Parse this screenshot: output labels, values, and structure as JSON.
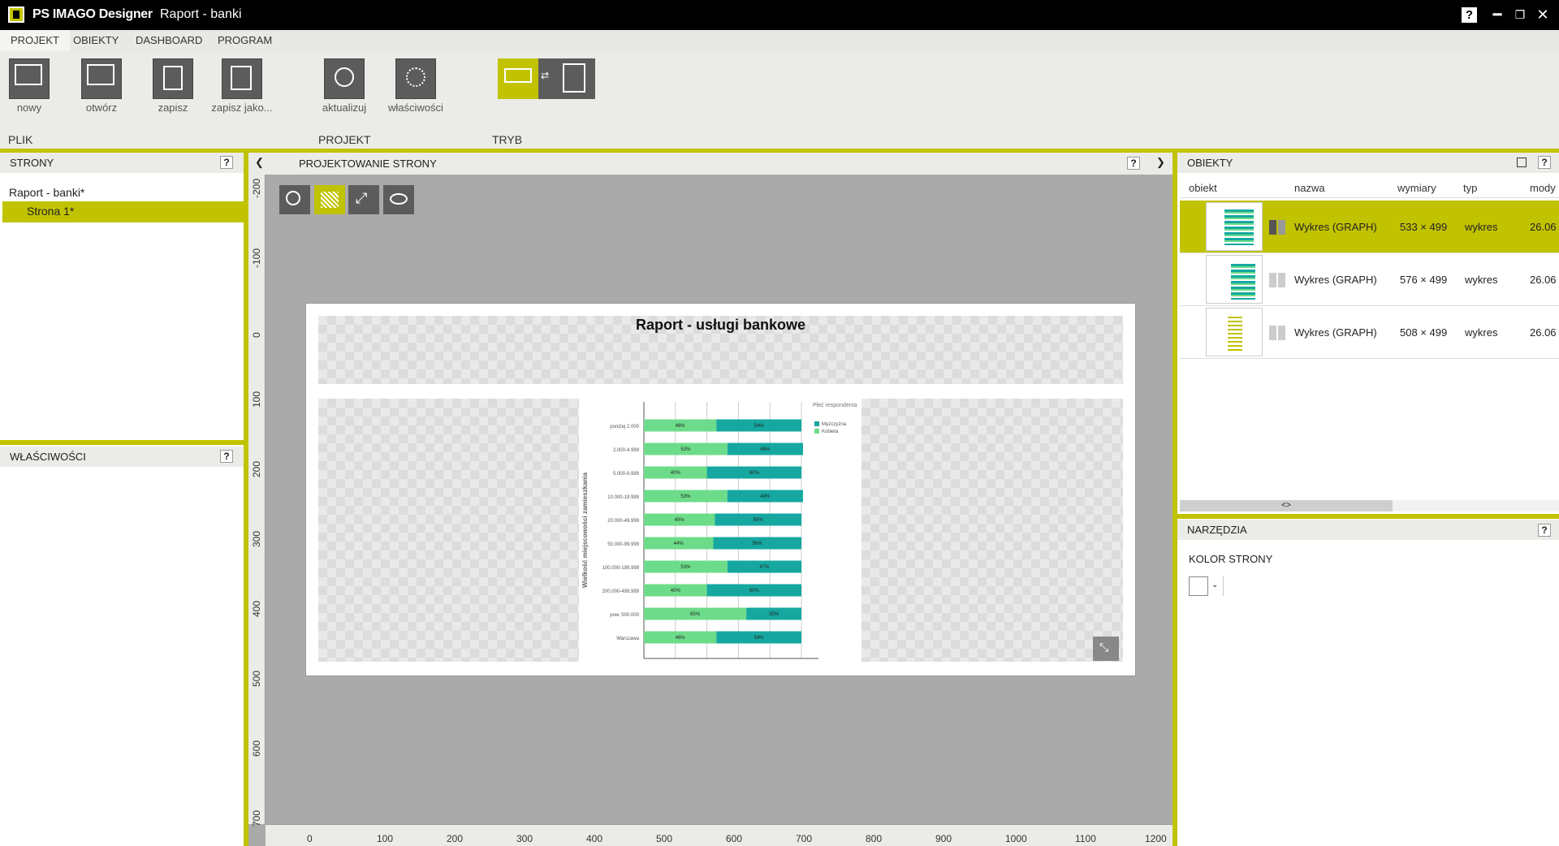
{
  "app": {
    "name": "PS IMAGO Designer",
    "document": "Raport - banki"
  },
  "menu": [
    "PROJEKT",
    "OBIEKTY",
    "DASHBOARD",
    "PROGRAM"
  ],
  "ribbon": {
    "buttons": [
      "nowy",
      "otwórz",
      "zapisz",
      "zapisz jako...",
      "aktualizuj",
      "właściwości"
    ],
    "groups": [
      "PLIK",
      "PROJEKT",
      "TRYB"
    ]
  },
  "left": {
    "pages_title": "STRONY",
    "project": "Raport - banki*",
    "page": "Strona 1*",
    "props_title": "WŁAŚCIWOŚCI"
  },
  "center": {
    "title": "PROJEKTOWANIE STRONY",
    "page_title": "Raport - usługi bankowe",
    "vruler": [
      "-200",
      "-100",
      "0",
      "100",
      "200",
      "300",
      "400",
      "500",
      "600",
      "700"
    ],
    "hruler": [
      "0",
      "100",
      "200",
      "300",
      "400",
      "500",
      "600",
      "700",
      "800",
      "900",
      "1000",
      "1100",
      "1200"
    ]
  },
  "chart_data": {
    "type": "bar",
    "stacked": true,
    "ylabel": "Wielkość miejscowości zamieszkania",
    "legend_title": "Płeć respondenta",
    "categories": [
      "poniżej 2.000",
      "2.000-4.999",
      "5.000-9.999",
      "10.000-19.999",
      "20.000-49.999",
      "50.000-99.999",
      "100.000-199.999",
      "200.000-499.999",
      "pow. 500.000",
      "Warszawa"
    ],
    "series": [
      {
        "name": "Kobieta",
        "color": "#6ddc8a",
        "values": [
          46,
          53,
          40,
          53,
          45,
          44,
          53,
          40,
          65,
          46
        ]
      },
      {
        "name": "Mężczyzna",
        "color": "#16a8a0",
        "values": [
          54,
          48,
          60,
          48,
          55,
          56,
          47,
          60,
          35,
          54
        ]
      }
    ],
    "labels": [
      [
        "46%",
        "54%"
      ],
      [
        "53%",
        "48%"
      ],
      [
        "40%",
        "60%"
      ],
      [
        "53%",
        "48%"
      ],
      [
        "45%",
        "55%"
      ],
      [
        "44%",
        "56%"
      ],
      [
        "53%",
        "47%"
      ],
      [
        "40%",
        "60%"
      ],
      [
        "65%",
        "35%"
      ],
      [
        "46%",
        "54%"
      ]
    ],
    "xlim": [
      0,
      100
    ]
  },
  "right": {
    "objects_title": "OBIEKTY",
    "columns": [
      "obiekt",
      "nazwa",
      "wymiary",
      "typ",
      "mody"
    ],
    "rows": [
      {
        "name": "Wykres (GRAPH)",
        "size": "533 × 499",
        "type": "wykres",
        "mod": "26.06"
      },
      {
        "name": "Wykres (GRAPH)",
        "size": "576 × 499",
        "type": "wykres",
        "mod": "26.06"
      },
      {
        "name": "Wykres (GRAPH)",
        "size": "508 × 499",
        "type": "wykres",
        "mod": "26.06"
      }
    ],
    "scroll": "<>",
    "tools_title": "NARZĘDZIA",
    "page_color_label": "KOLOR STRONY"
  },
  "help": "?"
}
